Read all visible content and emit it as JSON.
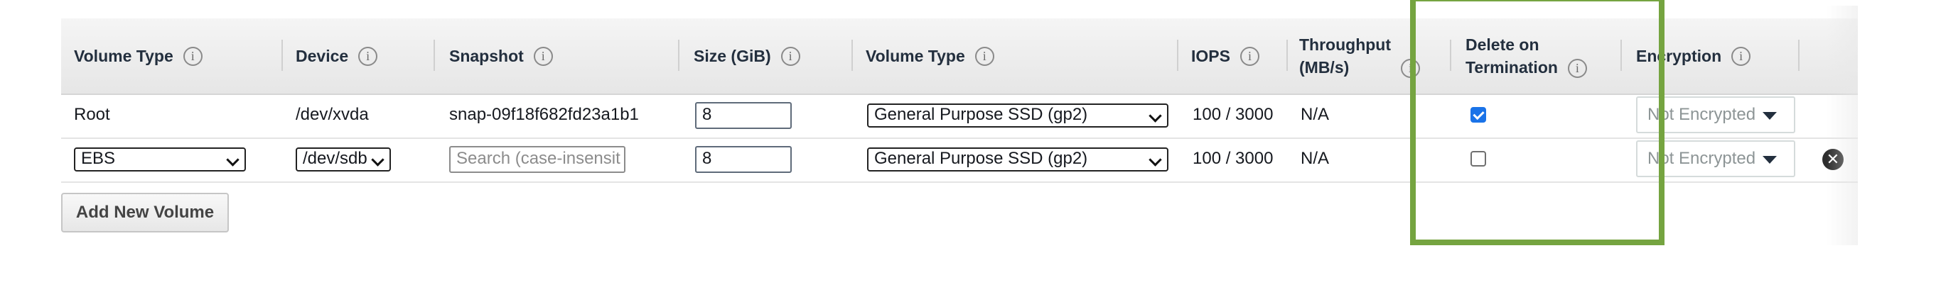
{
  "table": {
    "columns": [
      {
        "label": "Volume Type",
        "info_icon": "info-icon"
      },
      {
        "label": "Device",
        "info_icon": "info-icon"
      },
      {
        "label": "Snapshot",
        "info_icon": "info-icon"
      },
      {
        "label": "Size (GiB)",
        "info_icon": "info-icon"
      },
      {
        "label": "Volume Type",
        "info_icon": "info-icon"
      },
      {
        "label": "IOPS",
        "info_icon": "info-icon"
      },
      {
        "label": "Throughput\n(MB/s)",
        "info_icon": "info-icon"
      },
      {
        "label": "Delete on\nTermination",
        "info_icon": "info-icon"
      },
      {
        "label": "Encryption",
        "info_icon": "info-icon"
      }
    ],
    "info_glyph": "i",
    "rows": [
      {
        "volume_type": "Root",
        "device": "/dev/xvda",
        "snapshot": "snap-09f18f682fd23a1b1",
        "size": "8",
        "ebs_volume_type": "General Purpose SSD (gp2)",
        "iops": "100 / 3000",
        "throughput": "N/A",
        "delete_on_termination": true,
        "encryption": "Not Encrypted"
      },
      {
        "volume_type": "EBS",
        "device": "/dev/sdb",
        "snapshot_placeholder": "Search (case-insensit",
        "size": "8",
        "ebs_volume_type": "General Purpose SSD (gp2)",
        "iops": "100 / 3000",
        "throughput": "N/A",
        "delete_on_termination": false,
        "encryption": "Not Encrypted",
        "remove_icon": "close-circle-icon",
        "remove_glyph": "✕"
      }
    ]
  },
  "actions": {
    "add_new_volume": "Add New Volume"
  },
  "annotation": {
    "highlight_color": "#75a440",
    "highlighted_column": "Delete on Termination"
  },
  "colors": {
    "checkbox_checked": "#1a73e8",
    "header_bg": "#ececec"
  }
}
